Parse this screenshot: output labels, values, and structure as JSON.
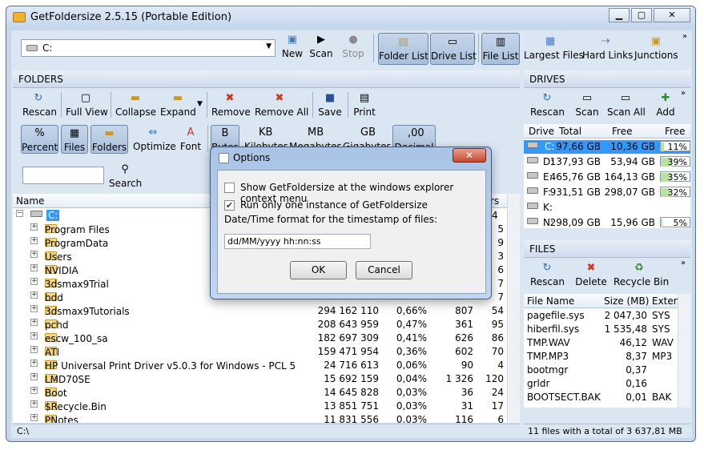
{
  "window": {
    "title": "GetFoldersize 2.5.15 (Portable Edition)",
    "caption_min": "▁",
    "caption_max": "▢",
    "caption_close": "✕"
  },
  "top_toolbar": {
    "path_value": "C:",
    "buttons": {
      "new": "New",
      "scan": "Scan",
      "stop": "Stop",
      "folder_list": "Folder List",
      "drive_list": "Drive List",
      "file_list": "File List",
      "largest_files": "Largest Files",
      "hard_links": "Hard Links",
      "junctions": "Junctions"
    }
  },
  "folders_panel": {
    "header": "FOLDERS",
    "buttons": {
      "rescan": "Rescan",
      "full_view": "Full View",
      "collapse": "Collapse",
      "expand": "Expand",
      "remove": "Remove",
      "remove_all": "Remove All",
      "save": "Save",
      "print": "Print"
    },
    "buttons2": {
      "percent": "Percent",
      "files": "Files",
      "folders": "Folders",
      "optimize": "Optimize",
      "font": "Font",
      "bytes_top": "B",
      "bytes": "Bytes",
      "kb_top": "KB",
      "kb": "Kilobytes",
      "mb_top": "MB",
      "mb": "Megabytes",
      "gb_top": "GB",
      "gb": "Gigabytes",
      "dec_top": ",00",
      "decimal": "Decimal"
    },
    "search_label": "Search",
    "column_name": "Name",
    "column_last": "rs",
    "root": "C:",
    "rows": [
      {
        "name": "Program Files",
        "size": "",
        "pct": "",
        "files": "",
        "folders": "5"
      },
      {
        "name": "ProgramData",
        "size": "",
        "pct": "",
        "files": "",
        "folders": "9"
      },
      {
        "name": "Users",
        "size": "",
        "pct": "",
        "files": "",
        "folders": "3"
      },
      {
        "name": "NVIDIA",
        "size": "",
        "pct": "",
        "files": "",
        "folders": "6"
      },
      {
        "name": "3dsmax9Trial",
        "size": "",
        "pct": "",
        "files": "",
        "folders": "7"
      },
      {
        "name": "bdd",
        "size": "",
        "pct": "",
        "files": "",
        "folders": "7"
      },
      {
        "name": "3dsmax9Tutorials",
        "size": "294 162 110",
        "pct": "0,66%",
        "files": "807",
        "folders": "54"
      },
      {
        "name": "pchd",
        "size": "208 643 959",
        "pct": "0,47%",
        "files": "361",
        "folders": "95"
      },
      {
        "name": "escw_100_sa",
        "size": "182 697 309",
        "pct": "0,41%",
        "files": "626",
        "folders": "86"
      },
      {
        "name": "ATI",
        "size": "159 471 954",
        "pct": "0,36%",
        "files": "602",
        "folders": "70"
      },
      {
        "name": "HP Universal Print Driver v5.0.3 for Windows - PCL 5",
        "size": "24 716 613",
        "pct": "0,06%",
        "files": "90",
        "folders": "4"
      },
      {
        "name": "LMD70SE",
        "size": "15 692 159",
        "pct": "0,04%",
        "files": "1 326",
        "folders": "120"
      },
      {
        "name": "Boot",
        "size": "14 645 828",
        "pct": "0,03%",
        "files": "36",
        "folders": "24"
      },
      {
        "name": "$Recycle.Bin",
        "size": "13 851 751",
        "pct": "0,03%",
        "files": "31",
        "folders": "17"
      },
      {
        "name": "PNotes",
        "size": "11 831 556",
        "pct": "0,03%",
        "files": "116",
        "folders": "6"
      }
    ],
    "root_last": "4",
    "status": "C:\\"
  },
  "drives_panel": {
    "header": "DRIVES",
    "buttons": {
      "rescan": "Rescan",
      "scan": "Scan",
      "scan_all": "Scan All",
      "add": "Add"
    },
    "columns": {
      "drive": "Drive",
      "total": "Total",
      "free": "Free",
      "free_pct": "Free"
    },
    "rows": [
      {
        "drive": "C:",
        "total": "97,66 GB",
        "free": "10,36 GB",
        "pct": "11%",
        "fraction": 0.11
      },
      {
        "drive": "D:",
        "total": "137,93 GB",
        "free": "53,94 GB",
        "pct": "39%",
        "fraction": 0.39
      },
      {
        "drive": "E:",
        "total": "465,76 GB",
        "free": "164,13 GB",
        "pct": "35%",
        "fraction": 0.35
      },
      {
        "drive": "F:",
        "total": "931,51 GB",
        "free": "298,07 GB",
        "pct": "32%",
        "fraction": 0.32
      },
      {
        "drive": "K:",
        "total": "",
        "free": "",
        "pct": "",
        "fraction": 0
      },
      {
        "drive": "N:",
        "total": "298,09 GB",
        "free": "15,96 GB",
        "pct": "5%",
        "fraction": 0.05
      }
    ]
  },
  "files_panel": {
    "header": "FILES",
    "buttons": {
      "rescan": "Rescan",
      "delete": "Delete",
      "recycle_bin": "Recycle Bin"
    },
    "columns": {
      "file_name": "File Name",
      "size": "Size (MB)",
      "ext": "Extensi"
    },
    "rows": [
      {
        "name": "pagefile.sys",
        "size": "2 047,30",
        "ext": "SYS"
      },
      {
        "name": "hiberfil.sys",
        "size": "1 535,48",
        "ext": "SYS"
      },
      {
        "name": "TMP.WAV",
        "size": "46,12",
        "ext": "WAV"
      },
      {
        "name": "TMP.MP3",
        "size": "8,37",
        "ext": "MP3"
      },
      {
        "name": "bootmgr",
        "size": "0,37",
        "ext": ""
      },
      {
        "name": "grldr",
        "size": "0,16",
        "ext": ""
      },
      {
        "name": "BOOTSECT.BAK",
        "size": "0,01",
        "ext": "BAK"
      }
    ],
    "status": "11 files with a total of 3 637,81 MB"
  },
  "dialog": {
    "title": "Options",
    "close": "✕",
    "opt1": "Show GetFoldersize at the windows explorer context menu",
    "opt1_checked": false,
    "opt2": "Run only one instance of GetFoldersize",
    "opt2_checked": true,
    "format_label": "Date/Time format for the timestamp of files:",
    "format_value": "dd/MM/yyyy hh:nn:ss",
    "ok": "OK",
    "cancel": "Cancel"
  }
}
